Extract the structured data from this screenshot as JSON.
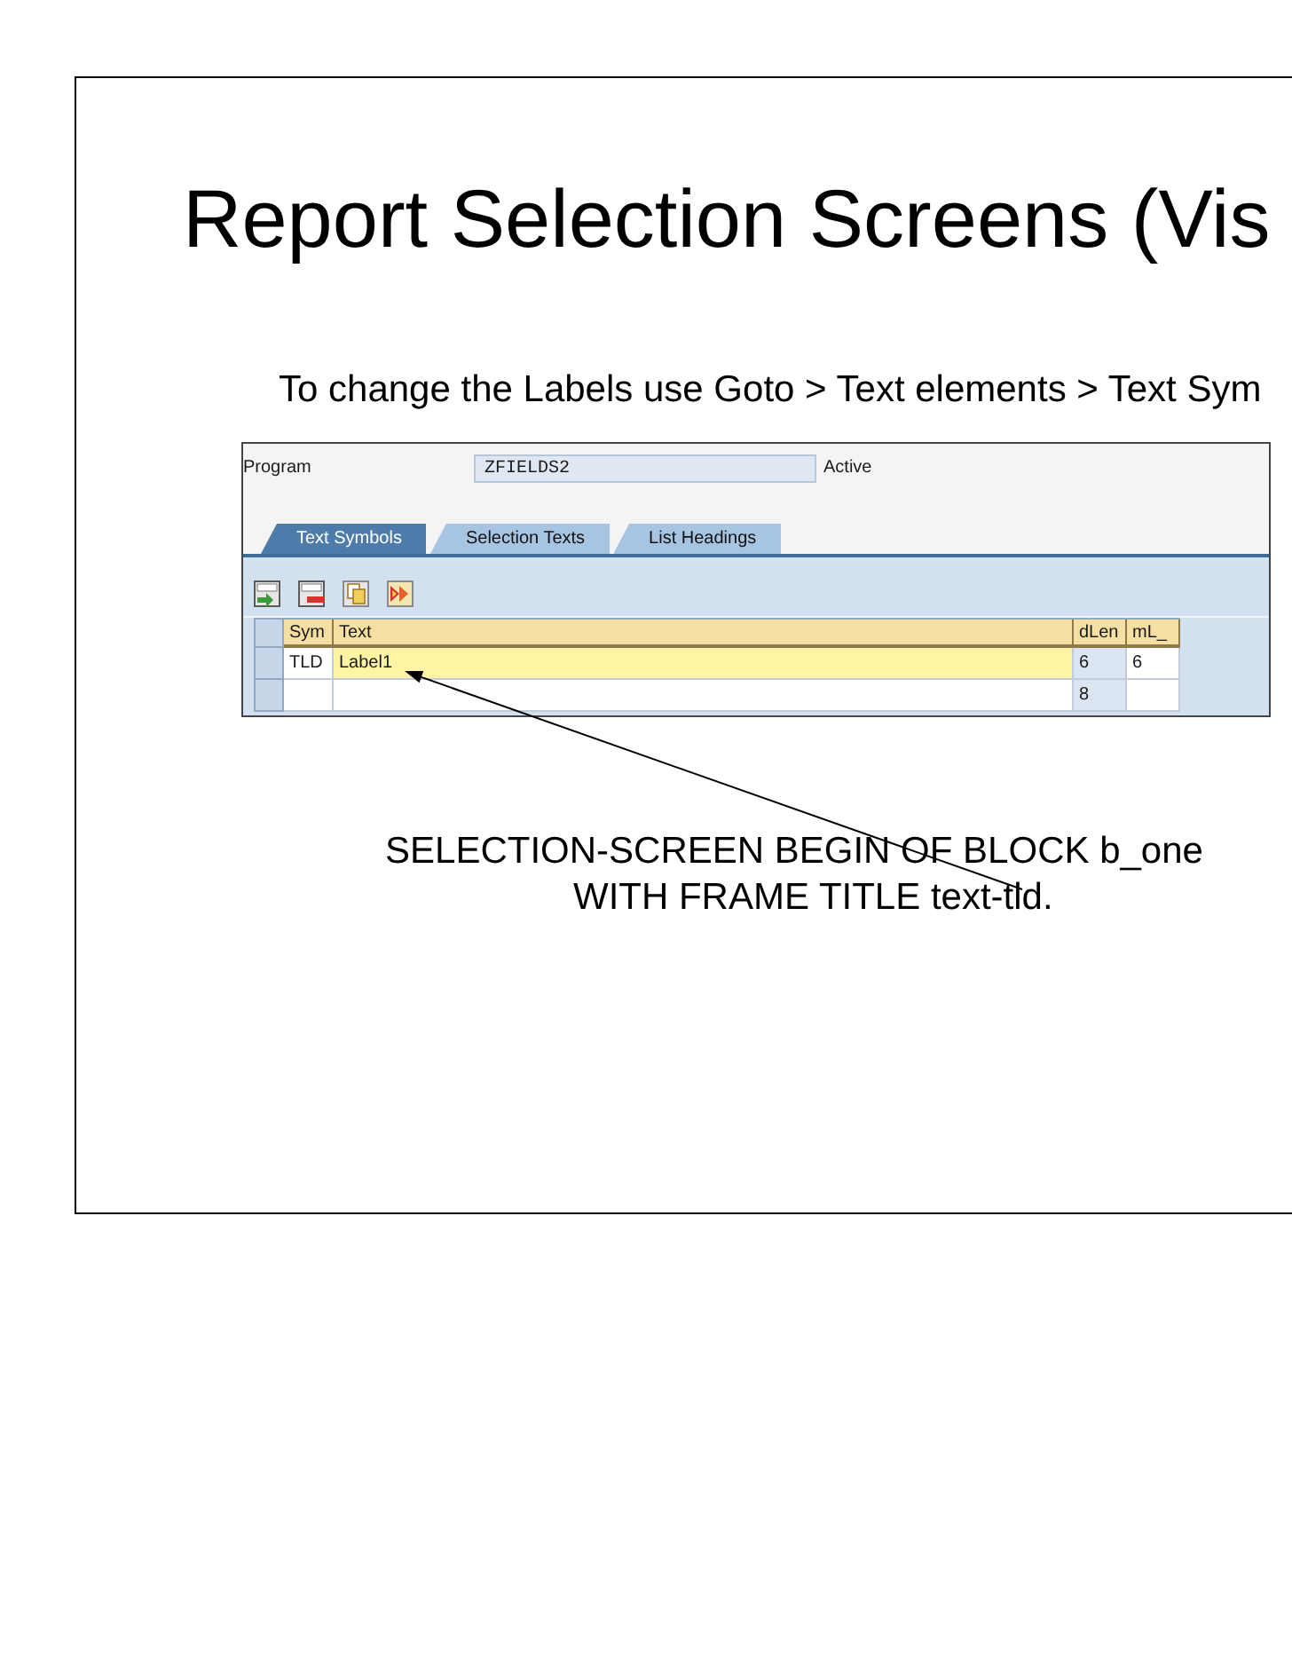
{
  "slide": {
    "title": "Report Selection Screens (Vis",
    "instruction": "To change the Labels use Goto > Text elements > Text Sym"
  },
  "sap_screen": {
    "program": {
      "label": "Program",
      "value": "ZFIELDS2",
      "status": "Active"
    },
    "tabs": [
      {
        "label": "Text Symbols",
        "selected": true
      },
      {
        "label": "Selection Texts",
        "selected": false
      },
      {
        "label": "List Headings",
        "selected": false
      }
    ],
    "table": {
      "columns": [
        "Sym",
        "Text",
        "dLen",
        "mL_"
      ],
      "rows": [
        {
          "selected": true,
          "sym": "TLD",
          "text": "Label1",
          "dlen": "6",
          "ml": "6"
        },
        {
          "selected": false,
          "dlen": "8"
        }
      ]
    }
  },
  "code": [
    "SELECTION-SCREEN BEGIN OF BLOCK b_one",
    "WITH FRAME TITLE text-tld."
  ]
}
